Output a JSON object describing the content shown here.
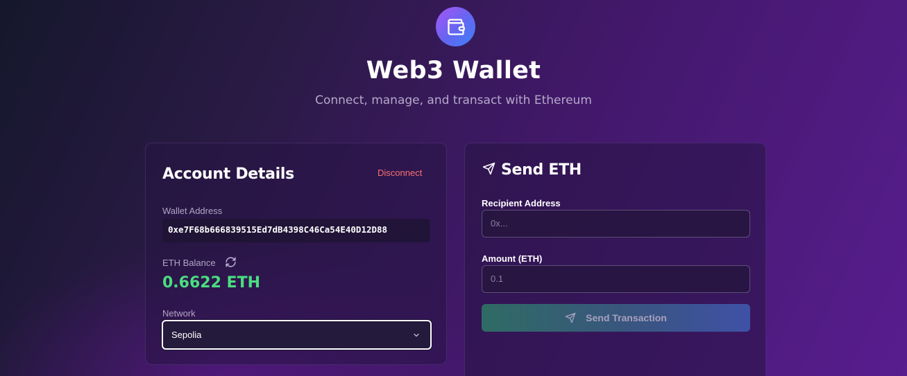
{
  "header": {
    "logo_icon": "wallet-icon",
    "title": "Web3 Wallet",
    "subtitle": "Connect, manage, and transact with Ethereum"
  },
  "account": {
    "title": "Account Details",
    "disconnect_label": "Disconnect",
    "wallet_address_label": "Wallet Address",
    "wallet_address": "0xe7F68b666839515Ed7dB4398C46Ca54E40D12D88",
    "balance_label": "ETH Balance",
    "balance_value": "0.6622 ETH",
    "network_label": "Network",
    "network_selected": "Sepolia"
  },
  "send": {
    "title": "Send ETH",
    "recipient_label": "Recipient Address",
    "recipient_placeholder": "0x...",
    "amount_label": "Amount (ETH)",
    "amount_placeholder": "0.1",
    "submit_label": "Send Transaction"
  },
  "colors": {
    "accent_green": "#4ade80",
    "disconnect_red": "#f87171",
    "logo_gradient_start": "#a855f7",
    "logo_gradient_end": "#3b82f6"
  }
}
